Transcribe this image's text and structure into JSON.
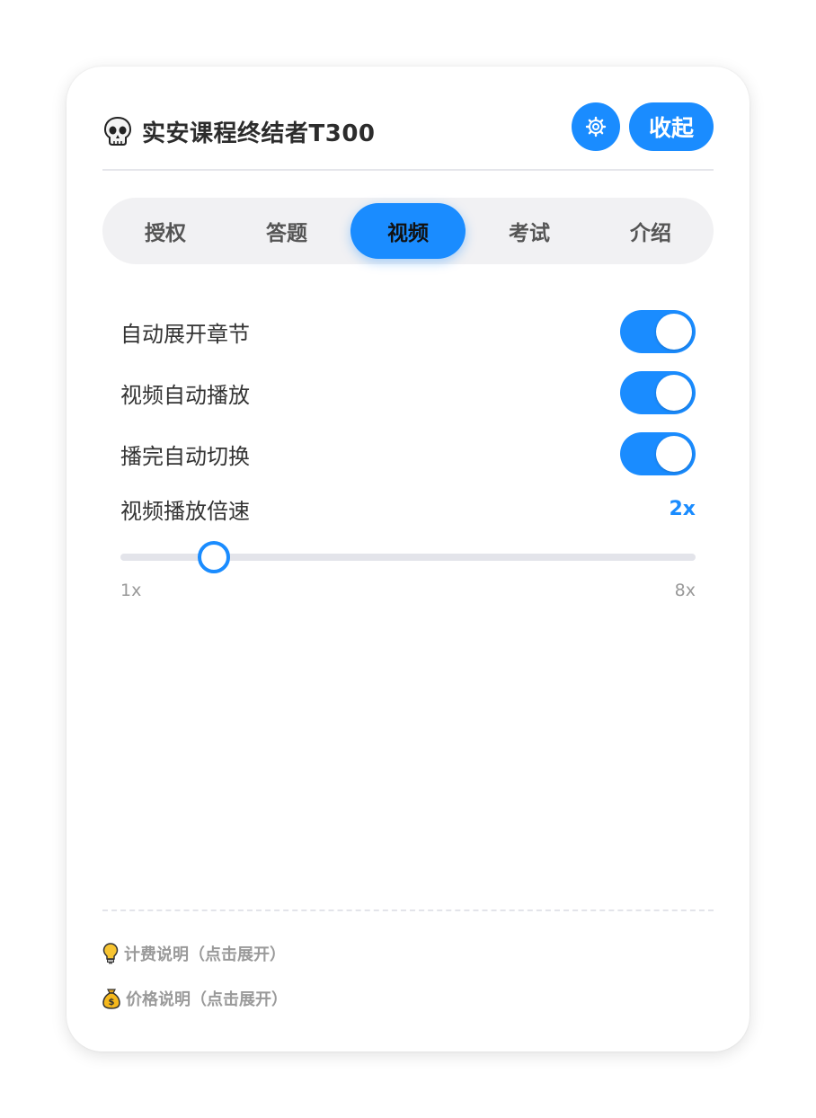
{
  "header": {
    "title": "实安课程终结者T300",
    "icon": "skull-icon",
    "settings_icon": "gear-icon",
    "collapse_label": "收起"
  },
  "tabs": [
    {
      "label": "授权",
      "active": false
    },
    {
      "label": "答题",
      "active": false
    },
    {
      "label": "视频",
      "active": true
    },
    {
      "label": "考试",
      "active": false
    },
    {
      "label": "介绍",
      "active": false
    }
  ],
  "settings": [
    {
      "label": "自动展开章节",
      "enabled": true
    },
    {
      "label": "视频自动播放",
      "enabled": true
    },
    {
      "label": "播完自动切换",
      "enabled": true
    }
  ],
  "speed": {
    "label": "视频播放倍速",
    "value_label": "2x",
    "value": 2,
    "min": 1,
    "max": 8,
    "min_label": "1x",
    "max_label": "8x"
  },
  "footer": {
    "billing_note": "计费说明（点击展开）",
    "billing_icon": "lightbulb-icon",
    "price_note": "价格说明（点击展开）",
    "price_icon": "money-bag-icon"
  },
  "colors": {
    "accent": "#1a8cff",
    "track": "#e3e4ea",
    "tab_bg": "#f1f1f3"
  }
}
